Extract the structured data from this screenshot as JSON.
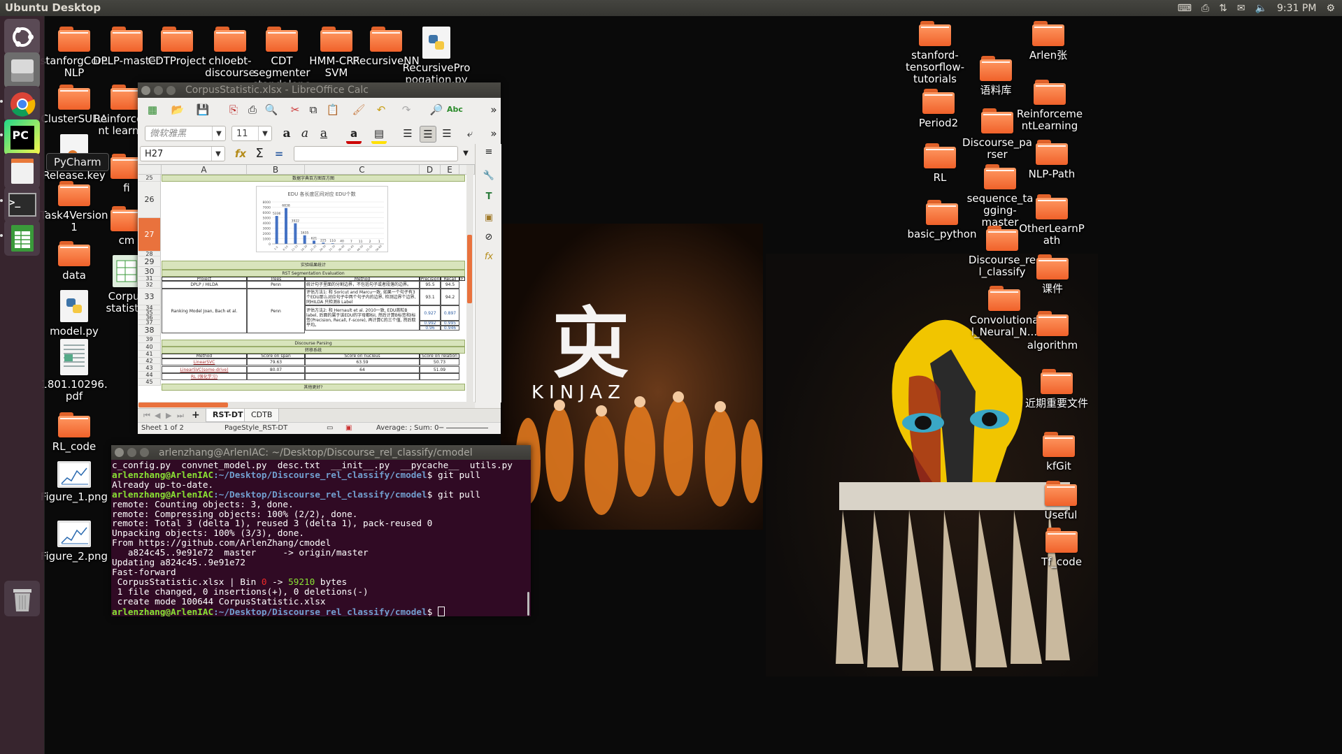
{
  "panel": {
    "title": "Ubuntu Desktop",
    "time": "9:31 PM",
    "tray_icons": [
      "keyboard-icon",
      "printer-icon",
      "network-transfer-icon",
      "mail-icon",
      "volume-icon",
      "gear-icon"
    ]
  },
  "launcher": {
    "items": [
      "ubuntu-dash",
      "files",
      "chrome",
      "pycharm",
      "text-editor",
      "terminal",
      "libreoffice-calc",
      "trash"
    ],
    "pycharm_badge": "PC",
    "terminal_prompt": ">_",
    "tooltip": "PyCharm"
  },
  "desktop_icons_left": [
    {
      "label": "stanforgCoreNLP",
      "type": "folder"
    },
    {
      "label": "DPLP-master",
      "type": "folder"
    },
    {
      "label": "CDTProject",
      "type": "folder"
    },
    {
      "label": "chloebt-discourse",
      "type": "folder"
    },
    {
      "label": "CDT segmenter standalone",
      "type": "folder"
    },
    {
      "label": "HMM-CRF-SVM",
      "type": "folder"
    },
    {
      "label": "RecursiveNN",
      "type": "folder"
    },
    {
      "label": "RecursivePropogation.py",
      "type": "python"
    },
    {
      "label": "ClusterSUDA",
      "type": "folder"
    },
    {
      "label": "Reinforcement learning",
      "type": "folder"
    },
    {
      "label": "Release.key",
      "type": "file"
    },
    {
      "label": "fi",
      "type": "folder"
    },
    {
      "label": "Task4Version1",
      "type": "folder"
    },
    {
      "label": "cm",
      "type": "folder"
    },
    {
      "label": "data",
      "type": "folder"
    },
    {
      "label": "Corpus statistic",
      "type": "spreadsheet"
    },
    {
      "label": "model.py",
      "type": "python"
    },
    {
      "label": "1801.10296.pdf",
      "type": "pdf"
    },
    {
      "label": "RL_code",
      "type": "folder"
    },
    {
      "label": "Figure_1.png",
      "type": "image"
    },
    {
      "label": "Figure_2.png",
      "type": "image"
    }
  ],
  "desktop_icons_right": [
    {
      "label": "stanford-tensorflow-tutorials"
    },
    {
      "label": "Arlen张"
    },
    {
      "label": "语料库"
    },
    {
      "label": "Period2"
    },
    {
      "label": "ReinforcementLearning"
    },
    {
      "label": "Discourse_parser"
    },
    {
      "label": "RL"
    },
    {
      "label": "NLP-Path"
    },
    {
      "label": "sequence_tagging-master"
    },
    {
      "label": "basic_python"
    },
    {
      "label": "OtherLearnPath"
    },
    {
      "label": "Discourse_rel_classify"
    },
    {
      "label": "课件"
    },
    {
      "label": "Convolutional_Neural_N..."
    },
    {
      "label": "algorithm"
    },
    {
      "label": "近期重要文件"
    },
    {
      "label": "kfGit"
    },
    {
      "label": "Useful"
    },
    {
      "label": "Tf_code"
    }
  ],
  "wallpaper": {
    "logo_text": "KINJAZ",
    "logo_glyph": "㐪"
  },
  "calc": {
    "title": "CorpusStatistic.xlsx - LibreOffice Calc",
    "font_name": "微软雅黑",
    "font_size": "11",
    "name_box": "H27",
    "formula": "",
    "columns": [
      "A",
      "B",
      "C",
      "D",
      "E"
    ],
    "rows": [
      "25",
      "26",
      "27",
      "28",
      "29",
      "30",
      "31",
      "32",
      "33",
      "34",
      "35",
      "36",
      "37",
      "38",
      "39",
      "40",
      "41",
      "42",
      "43",
      "44",
      "45"
    ],
    "row25_title": "数据字典百方图百方图",
    "row29_title": "实验结果统计",
    "row30_title": "RST Segmentation Evaluation",
    "seg_table": {
      "headers": [
        "Project",
        "Trees",
        "Method",
        "Precision",
        "Recall",
        "F"
      ],
      "rows": [
        {
          "project": "DPLP / HILDA",
          "trees": "Penn",
          "method": "统计句子里面的分割边界，不包括句子或者段落的边界。",
          "precision": "95.5",
          "recall": "94.5"
        },
        {
          "project": "Ranking Model Joan, Bach et al.",
          "trees": "Penn",
          "method": "评估方法1: 和 Soricut and Marcu一致, 如果一个句子有3个EDU那么对应句子中两个句子内的边界, 检测边界个边界, 同HILDA 只检测B Label",
          "precision": "93.1",
          "recall": "94.2"
        },
        {
          "project": "",
          "trees": "",
          "method": "评估方法2: 和 Hernault et al. 2010一致, EDU首粒B label, 后面的属于该EDU的字母都标I, 然后计算B标签和I标签(Precision, Recall, F-score), 再计算C的三个值, 然后取平均。",
          "precision": "0.927",
          "recall": "0.897"
        },
        {
          "project": "",
          "trees": "",
          "method": "",
          "precision": "0.992",
          "recall": "0.995"
        },
        {
          "project": "",
          "trees": "",
          "method": "",
          "precision": "0.96",
          "recall": "0.946"
        }
      ]
    },
    "row38_title": "Discourse Parsing",
    "row39_title": "转移系统",
    "parse_table": {
      "headers": [
        "Method",
        "Score on span",
        "Score on nucleus",
        "Score on relation"
      ],
      "rows": [
        {
          "method": "LinearSVC",
          "span": "79.63",
          "nucleus": "63.59",
          "relation": "50.73"
        },
        {
          "method": "LinearSVC(some-drive)",
          "span": "80.07",
          "nucleus": "64",
          "relation": "51.09"
        },
        {
          "method": "RL (强化学习)",
          "span": "",
          "nucleus": "",
          "relation": ""
        }
      ]
    },
    "row44_title": "其他更好?",
    "sheet_tabs": [
      "RST-DT",
      "CDTB"
    ],
    "active_tab": "RST-DT",
    "status": {
      "sheet": "Sheet 1 of 2",
      "page_style": "PageStyle_RST-DT",
      "summary": "Average: ; Sum: 0"
    }
  },
  "chart_data": {
    "type": "bar",
    "title": "EDU 各长度区间对应 EDU个数",
    "categories": [
      "1-5",
      "6-10",
      "11-15",
      "16-20",
      "21-25",
      "26-30",
      "31-35",
      "36-40",
      "41-45",
      "46-50",
      "51-55",
      "56-60"
    ],
    "values": [
      5336,
      6838,
      3922,
      1635,
      621,
      225,
      110,
      40,
      7,
      11,
      2,
      1
    ],
    "ylim": [
      0,
      8000
    ],
    "yticks": [
      "0",
      "1000",
      "2000",
      "3000",
      "4000",
      "5000",
      "6000",
      "7000",
      "8000"
    ],
    "grid": true,
    "color": "#4472c4"
  },
  "terminal": {
    "title": "arlenzhang@ArlenIAC: ~/Desktop/Discourse_rel_classify/cmodel",
    "user_host": "arlenzhang@ArlenIAC",
    "path": ":~/Desktop/Discourse_rel_classify/cmodel",
    "prompt_end": "$ ",
    "ls_line": "c_config.py  convnet_model.py  desc.txt  __init__.py  __pycache__  utils.py",
    "cmd1": "git pull",
    "out1": "Already up-to-date.",
    "cmd2": "git pull",
    "out2": [
      "remote: Counting objects: 3, done.",
      "remote: Compressing objects: 100% (2/2), done.",
      "remote: Total 3 (delta 1), reused 3 (delta 1), pack-reused 0",
      "Unpacking objects: 100% (3/3), done.",
      "From https://github.com/ArlenZhang/cmodel",
      "   a824c45..9e91e72  master     -> origin/master",
      "Updating a824c45..9e91e72",
      "Fast-forward"
    ],
    "diff_file": " CorpusStatistic.xlsx | Bin ",
    "diff_old": "0",
    "diff_arrow": " -> ",
    "diff_new": "59210",
    "diff_unit": " bytes",
    "summary": " 1 file changed, 0 insertions(+), 0 deletions(-)",
    "create": " create mode 100644 CorpusStatistic.xlsx"
  }
}
